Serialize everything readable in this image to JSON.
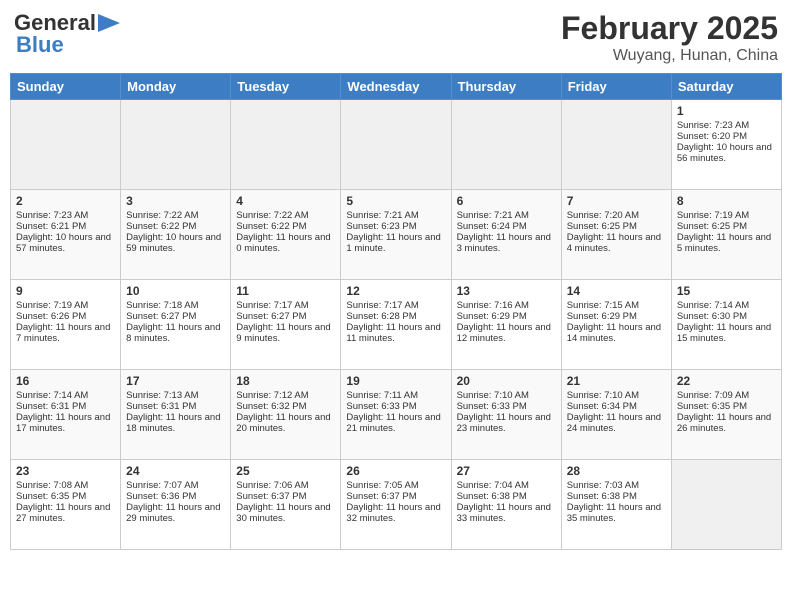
{
  "header": {
    "logo_general": "General",
    "logo_blue": "Blue",
    "title": "February 2025",
    "subtitle": "Wuyang, Hunan, China"
  },
  "calendar": {
    "days_of_week": [
      "Sunday",
      "Monday",
      "Tuesday",
      "Wednesday",
      "Thursday",
      "Friday",
      "Saturday"
    ],
    "weeks": [
      [
        {
          "day": "",
          "empty": true
        },
        {
          "day": "",
          "empty": true
        },
        {
          "day": "",
          "empty": true
        },
        {
          "day": "",
          "empty": true
        },
        {
          "day": "",
          "empty": true
        },
        {
          "day": "",
          "empty": true
        },
        {
          "day": "1",
          "sunrise": "7:23 AM",
          "sunset": "6:20 PM",
          "daylight": "10 hours and 56 minutes."
        }
      ],
      [
        {
          "day": "2",
          "sunrise": "7:23 AM",
          "sunset": "6:21 PM",
          "daylight": "10 hours and 57 minutes."
        },
        {
          "day": "3",
          "sunrise": "7:22 AM",
          "sunset": "6:22 PM",
          "daylight": "10 hours and 59 minutes."
        },
        {
          "day": "4",
          "sunrise": "7:22 AM",
          "sunset": "6:22 PM",
          "daylight": "11 hours and 0 minutes."
        },
        {
          "day": "5",
          "sunrise": "7:21 AM",
          "sunset": "6:23 PM",
          "daylight": "11 hours and 1 minute."
        },
        {
          "day": "6",
          "sunrise": "7:21 AM",
          "sunset": "6:24 PM",
          "daylight": "11 hours and 3 minutes."
        },
        {
          "day": "7",
          "sunrise": "7:20 AM",
          "sunset": "6:25 PM",
          "daylight": "11 hours and 4 minutes."
        },
        {
          "day": "8",
          "sunrise": "7:19 AM",
          "sunset": "6:25 PM",
          "daylight": "11 hours and 5 minutes."
        }
      ],
      [
        {
          "day": "9",
          "sunrise": "7:19 AM",
          "sunset": "6:26 PM",
          "daylight": "11 hours and 7 minutes."
        },
        {
          "day": "10",
          "sunrise": "7:18 AM",
          "sunset": "6:27 PM",
          "daylight": "11 hours and 8 minutes."
        },
        {
          "day": "11",
          "sunrise": "7:17 AM",
          "sunset": "6:27 PM",
          "daylight": "11 hours and 9 minutes."
        },
        {
          "day": "12",
          "sunrise": "7:17 AM",
          "sunset": "6:28 PM",
          "daylight": "11 hours and 11 minutes."
        },
        {
          "day": "13",
          "sunrise": "7:16 AM",
          "sunset": "6:29 PM",
          "daylight": "11 hours and 12 minutes."
        },
        {
          "day": "14",
          "sunrise": "7:15 AM",
          "sunset": "6:29 PM",
          "daylight": "11 hours and 14 minutes."
        },
        {
          "day": "15",
          "sunrise": "7:14 AM",
          "sunset": "6:30 PM",
          "daylight": "11 hours and 15 minutes."
        }
      ],
      [
        {
          "day": "16",
          "sunrise": "7:14 AM",
          "sunset": "6:31 PM",
          "daylight": "11 hours and 17 minutes."
        },
        {
          "day": "17",
          "sunrise": "7:13 AM",
          "sunset": "6:31 PM",
          "daylight": "11 hours and 18 minutes."
        },
        {
          "day": "18",
          "sunrise": "7:12 AM",
          "sunset": "6:32 PM",
          "daylight": "11 hours and 20 minutes."
        },
        {
          "day": "19",
          "sunrise": "7:11 AM",
          "sunset": "6:33 PM",
          "daylight": "11 hours and 21 minutes."
        },
        {
          "day": "20",
          "sunrise": "7:10 AM",
          "sunset": "6:33 PM",
          "daylight": "11 hours and 23 minutes."
        },
        {
          "day": "21",
          "sunrise": "7:10 AM",
          "sunset": "6:34 PM",
          "daylight": "11 hours and 24 minutes."
        },
        {
          "day": "22",
          "sunrise": "7:09 AM",
          "sunset": "6:35 PM",
          "daylight": "11 hours and 26 minutes."
        }
      ],
      [
        {
          "day": "23",
          "sunrise": "7:08 AM",
          "sunset": "6:35 PM",
          "daylight": "11 hours and 27 minutes."
        },
        {
          "day": "24",
          "sunrise": "7:07 AM",
          "sunset": "6:36 PM",
          "daylight": "11 hours and 29 minutes."
        },
        {
          "day": "25",
          "sunrise": "7:06 AM",
          "sunset": "6:37 PM",
          "daylight": "11 hours and 30 minutes."
        },
        {
          "day": "26",
          "sunrise": "7:05 AM",
          "sunset": "6:37 PM",
          "daylight": "11 hours and 32 minutes."
        },
        {
          "day": "27",
          "sunrise": "7:04 AM",
          "sunset": "6:38 PM",
          "daylight": "11 hours and 33 minutes."
        },
        {
          "day": "28",
          "sunrise": "7:03 AM",
          "sunset": "6:38 PM",
          "daylight": "11 hours and 35 minutes."
        },
        {
          "day": "",
          "empty": true
        }
      ]
    ]
  }
}
